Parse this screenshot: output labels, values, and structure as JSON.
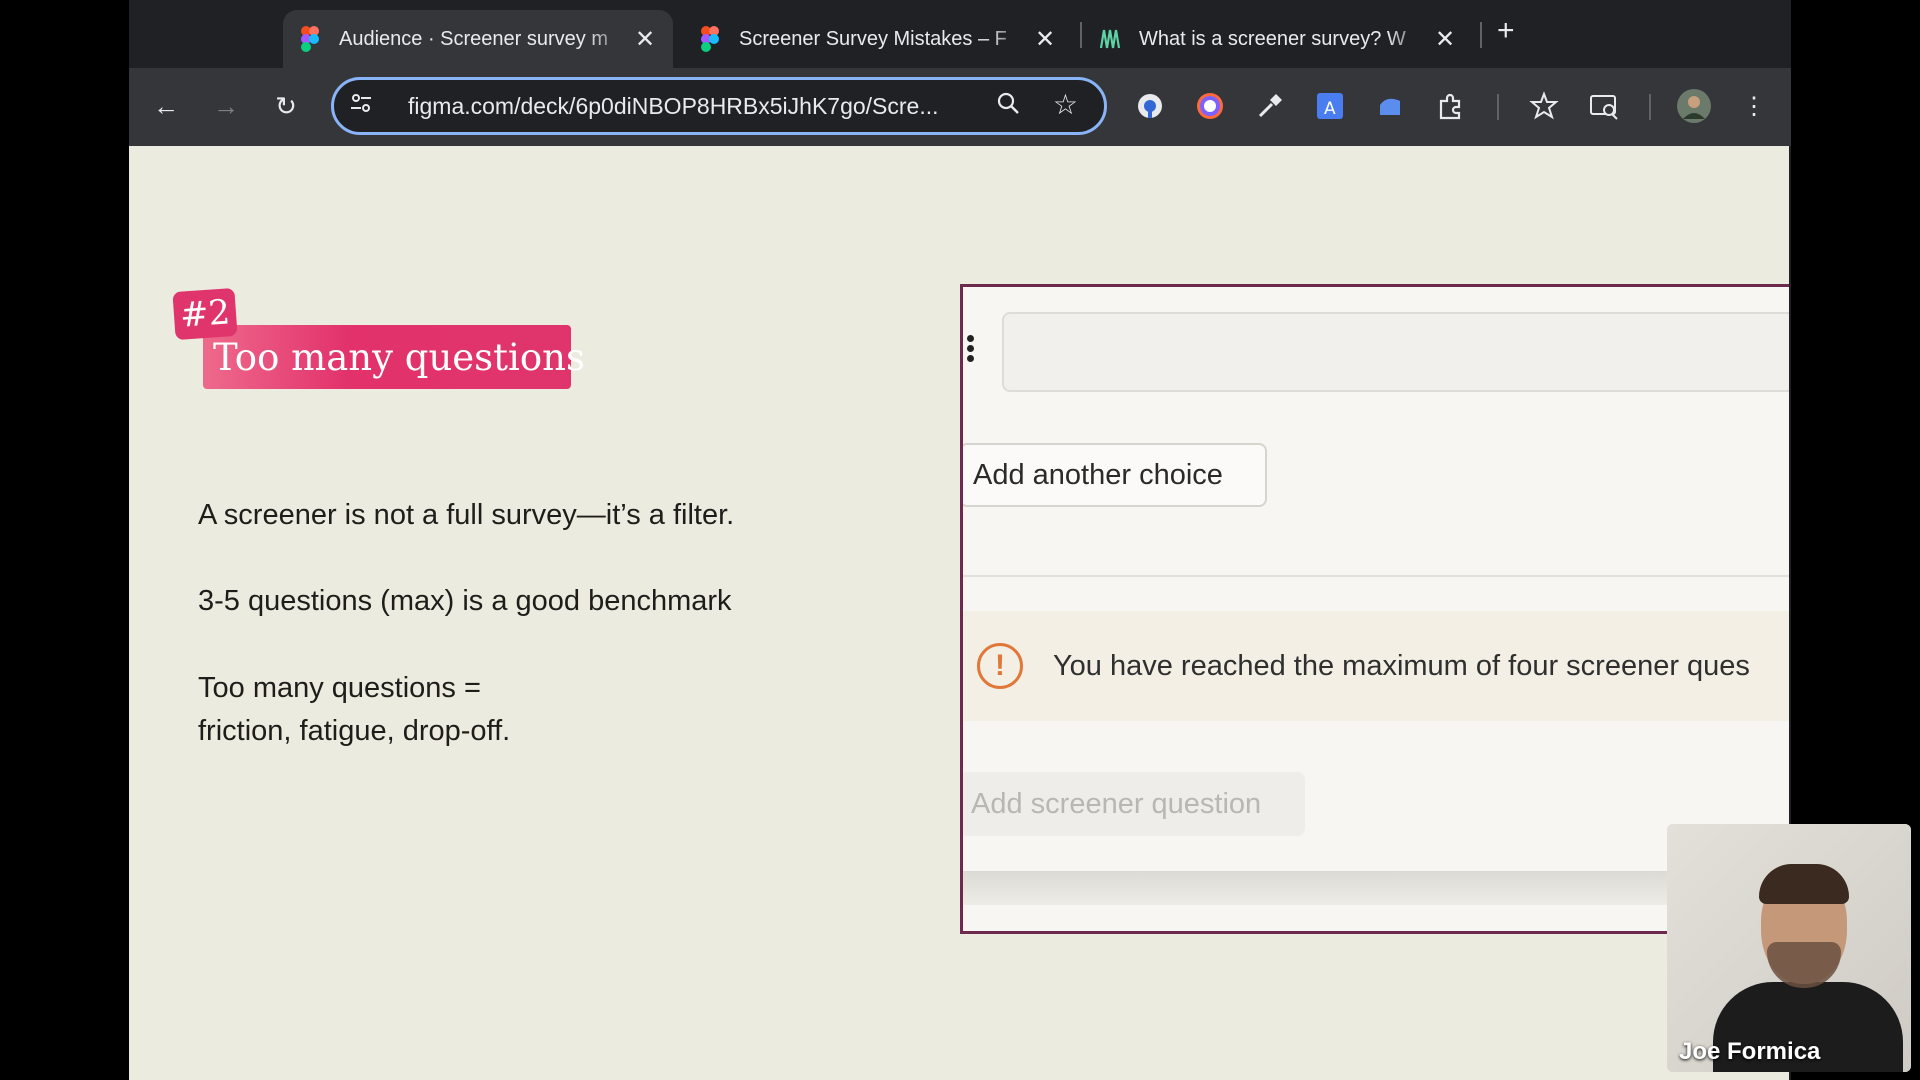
{
  "browser": {
    "tabs": [
      {
        "title": "Audience · Screener survey m",
        "favicon": "figma-icon",
        "active": true
      },
      {
        "title": "Screener Survey Mistakes – F",
        "favicon": "figma-icon",
        "active": false
      },
      {
        "title": "What is a screener survey? W",
        "favicon": "site-icon",
        "active": false
      }
    ],
    "close_glyph": "✕",
    "new_tab_glyph": "+",
    "url": "figma.com/deck/6p0diNBOP8HRBx5iJhK7go/Scre..."
  },
  "slide": {
    "badge": "#2",
    "heading": "Too many questions",
    "bullets": [
      "A screener is not a full survey—it’s a filter.",
      "3-5 questions (max) is a good benchmark",
      "Too many questions =",
      "friction, fatigue, drop-off."
    ]
  },
  "panel": {
    "add_choice_label": "Add another choice",
    "alert_message": "You have reached the maximum of four screener ques",
    "alert_icon": "exclamation-icon",
    "add_question_label": "Add screener question"
  },
  "webcam": {
    "name": "Joe Formica"
  },
  "colors": {
    "accent_pink": "#e0356c",
    "panel_border": "#6e2a4e",
    "slide_bg": "#ecebdf",
    "alert_icon": "#e0783a"
  }
}
